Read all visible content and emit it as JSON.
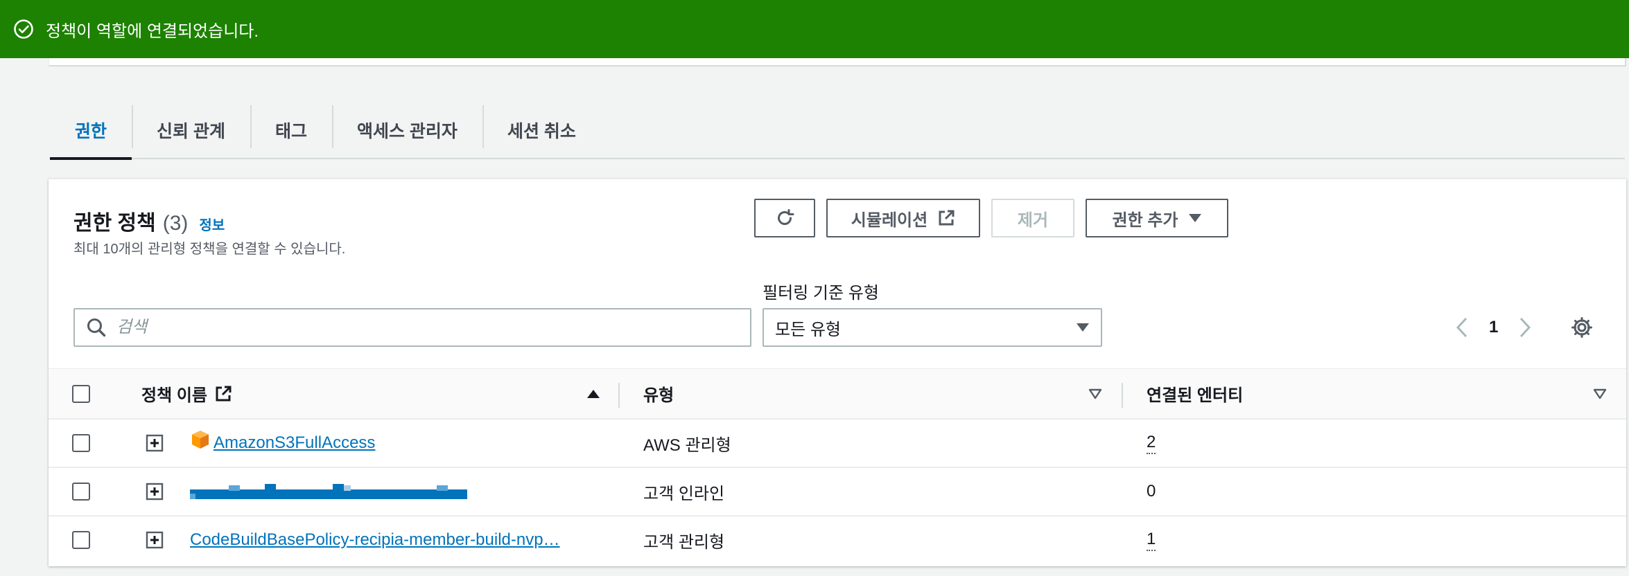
{
  "flash": {
    "message": "정책이 역할에 연결되었습니다."
  },
  "tabs": [
    {
      "label": "권한",
      "active": true
    },
    {
      "label": "신뢰 관계"
    },
    {
      "label": "태그"
    },
    {
      "label": "액세스 관리자"
    },
    {
      "label": "세션 취소"
    }
  ],
  "panel": {
    "title": "권한 정책",
    "count": "(3)",
    "info_link": "정보",
    "description": "최대 10개의 관리형 정책을 연결할 수 있습니다.",
    "buttons": {
      "simulate": "시뮬레이션",
      "remove": "제거",
      "add": "권한 추가"
    },
    "filter_label": "필터링 기준 유형",
    "search_placeholder": "검색",
    "filter_value": "모든 유형",
    "page": "1"
  },
  "table": {
    "columns": {
      "name": "정책 이름",
      "type": "유형",
      "entities": "연결된 엔터티"
    },
    "rows": [
      {
        "name": "AmazonS3FullAccess",
        "type": "AWS 관리형",
        "entities": "2"
      },
      {
        "name": "",
        "type": "고객 인라인",
        "entities": "0"
      },
      {
        "name": "CodeBuildBasePolicy-recipia-member-build-nvp…",
        "type": "고객 관리형",
        "entities": "1"
      }
    ]
  },
  "colors": {
    "success": "#1d8102",
    "link": "#0073bb",
    "aws_orange": "#ff9900"
  }
}
